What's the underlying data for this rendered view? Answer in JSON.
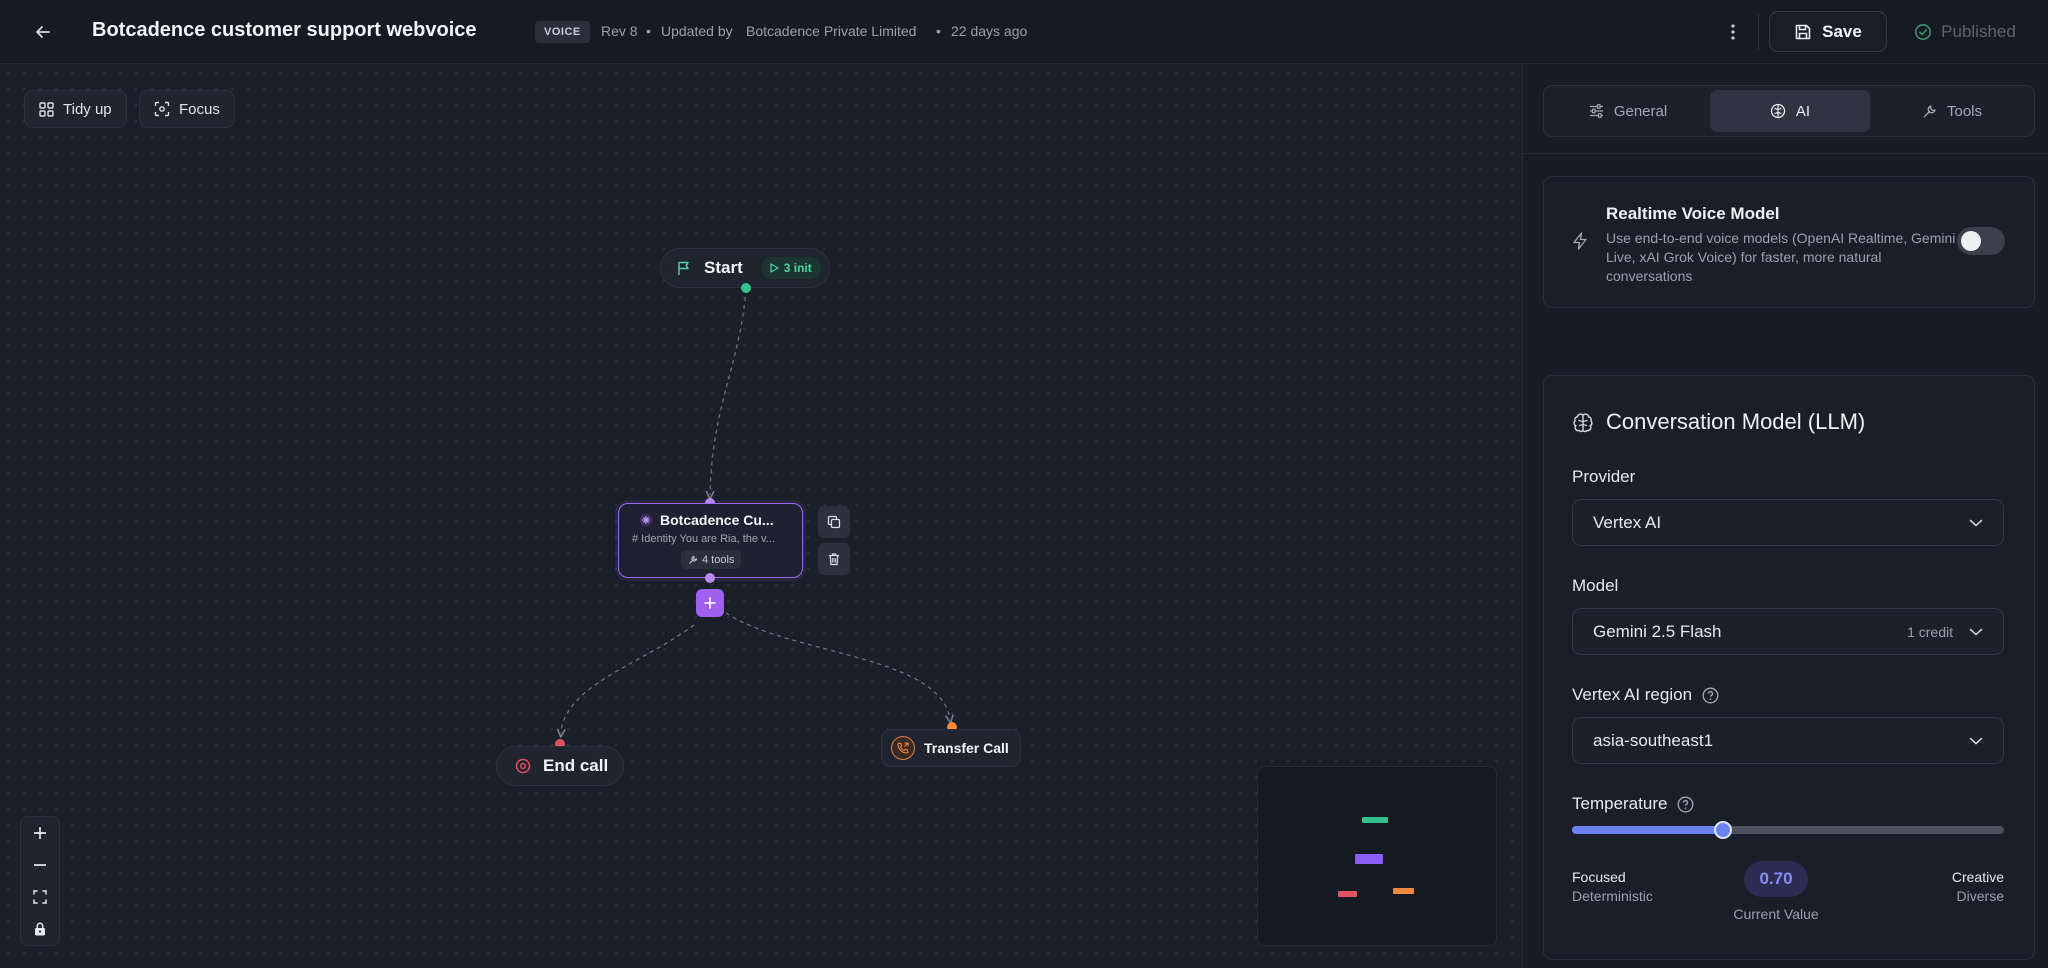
{
  "header": {
    "title": "Botcadence customer support webvoice",
    "badge": "VOICE",
    "rev": "Rev 8",
    "dot": "•",
    "updated_by_label": "Updated by",
    "updated_by": "Botcadence Private Limited",
    "updated_ago": "22 days ago",
    "save_label": "Save",
    "published_label": "Published"
  },
  "canvas": {
    "tidy_label": "Tidy up",
    "focus_label": "Focus",
    "start": {
      "label": "Start",
      "init_badge": "3 init"
    },
    "agent": {
      "title": "Botcadence Cu...",
      "subtitle": "# Identity You are Ria, the v...",
      "tools": "4 tools"
    },
    "end_call": {
      "label": "End call"
    },
    "transfer": {
      "label": "Transfer Call"
    }
  },
  "panel": {
    "tabs": [
      {
        "label": "General",
        "icon": "sliders-icon",
        "active": false
      },
      {
        "label": "AI",
        "icon": "brain-icon",
        "active": true
      },
      {
        "label": "Tools",
        "icon": "wrench-icon",
        "active": false
      }
    ],
    "realtime": {
      "title": "Realtime Voice Model",
      "description": "Use end-to-end voice models (OpenAI Realtime, Gemini Live, xAI Grok Voice) for faster, more natural conversations",
      "enabled": false
    },
    "llm": {
      "title": "Conversation Model (LLM)",
      "provider_label": "Provider",
      "provider_value": "Vertex AI",
      "model_label": "Model",
      "model_value": "Gemini 2.5 Flash",
      "model_credit": "1 credit",
      "region_label": "Vertex AI region",
      "region_value": "asia-southeast1",
      "temperature_label": "Temperature",
      "temperature": 0.7,
      "temperature_display": "0.70",
      "left_label": "Focused",
      "left_sub": "Deterministic",
      "right_label": "Creative",
      "right_sub": "Diverse",
      "current_value_label": "Current Value"
    }
  },
  "colors": {
    "accent_purple": "#a15ff0",
    "start_green": "#34c38f",
    "end_red": "#e05263",
    "transfer_orange": "#f0883e",
    "slider_blue": "#6b83f0"
  }
}
